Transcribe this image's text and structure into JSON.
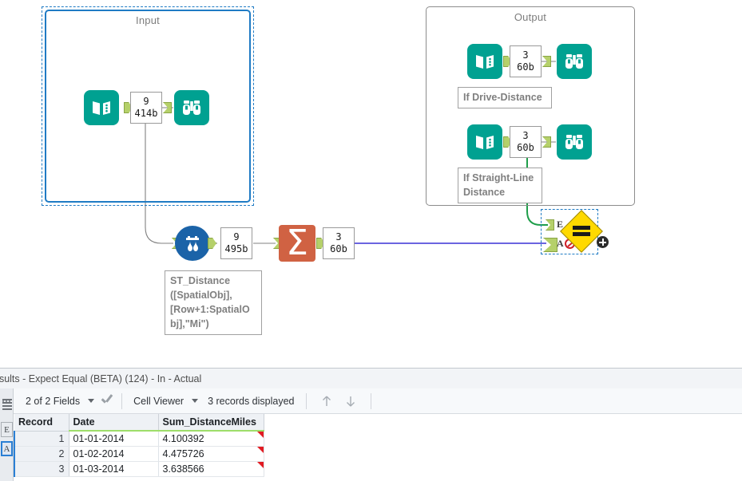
{
  "canvas": {
    "containers": [
      {
        "id": "input",
        "title": "Input",
        "selected": true
      },
      {
        "id": "output",
        "title": "Output",
        "selected": false
      }
    ],
    "nodes": {
      "input_text_input": {
        "icon": "book-icon",
        "name": "text-input-tool"
      },
      "input_browse": {
        "icon": "binoculars-icon",
        "name": "browse-tool"
      },
      "input_records": {
        "count": "9",
        "size": "414b"
      },
      "out1_text_input": {
        "icon": "book-icon",
        "name": "text-input-tool"
      },
      "out1_browse": {
        "icon": "binoculars-icon",
        "name": "browse-tool"
      },
      "out1_records": {
        "count": "3",
        "size": "60b"
      },
      "out1_annotation": "If Drive-Distance",
      "out2_text_input": {
        "icon": "book-icon",
        "name": "text-input-tool"
      },
      "out2_browse": {
        "icon": "binoculars-icon",
        "name": "browse-tool"
      },
      "out2_records": {
        "count": "3",
        "size": "60b"
      },
      "out2_annotation": "If Straight-Line\nDistance",
      "formula_tool": {
        "icon": "formula-drop-icon",
        "name": "formula-tool"
      },
      "formula_records": {
        "count": "9",
        "size": "495b"
      },
      "formula_annotation": "ST_Distance\n([SpatialObj],\n[Row+1:SpatialO\nbj],\"Mi\")",
      "summarize_tool": {
        "icon": "sigma-icon",
        "name": "summarize-tool",
        "glyph": "Σ"
      },
      "summarize_records": {
        "count": "3",
        "size": "60b"
      },
      "test_tool": {
        "name": "expect-equal-tool",
        "glyph": "=",
        "anchor_e": "E",
        "anchor_a": "A",
        "error_badge": "error-icon",
        "add_badge": "plus-icon",
        "selected": true
      }
    },
    "colors": {
      "teal": "#00a191",
      "blue": "#1b63a8",
      "summarize": "#d06243",
      "diamond": "#ffd900",
      "anchor_green": "#b5d06a",
      "selection_blue": "#1f7bc4",
      "connector_gray": "#808080",
      "connector_blue": "#3a30d6",
      "connector_green": "#1f9e4a",
      "error_red": "#cf2027"
    }
  },
  "results": {
    "title": "esults - Expect Equal (BETA) (124) - In - Actual",
    "rail": {
      "grip": "grip-dots-icon",
      "menu": "list-icon",
      "tabs": [
        {
          "label": "E",
          "selected": false
        },
        {
          "label": "A",
          "selected": true
        }
      ]
    },
    "toolbar": {
      "fields_label": "2 of 2 Fields",
      "fields_caret": "chevron-down-icon",
      "check_icon": "check-icon",
      "viewer_label": "Cell Viewer",
      "viewer_caret": "chevron-down-icon",
      "records_label": "3 records displayed",
      "up_icon": "arrow-up-icon",
      "down_icon": "arrow-down-icon"
    },
    "grid": {
      "columns": [
        "Record",
        "Date",
        "Sum_DistanceMiles"
      ],
      "rows": [
        {
          "record": "1",
          "date": "01-01-2014",
          "sum": "4.100392"
        },
        {
          "record": "2",
          "date": "01-02-2014",
          "sum": "4.475726"
        },
        {
          "record": "3",
          "date": "01-03-2014",
          "sum": "3.638566"
        }
      ]
    }
  }
}
